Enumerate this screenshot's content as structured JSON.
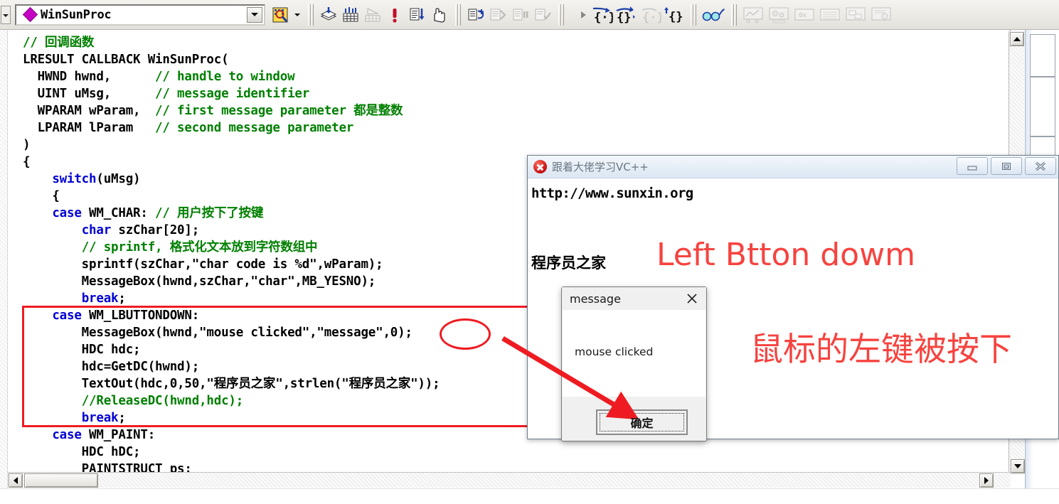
{
  "toolbar": {
    "combo_value": "WinSunProc",
    "combo_dropdown_label": "▼",
    "icons": [
      {
        "name": "left-stub-dropdown",
        "label": "▼"
      },
      {
        "name": "class-member-filter-icon",
        "label": ""
      },
      {
        "name": "compile-icon",
        "label": ""
      },
      {
        "name": "build-icon",
        "label": ""
      },
      {
        "name": "stop-build-icon",
        "label": ""
      },
      {
        "name": "execute-program-icon",
        "label": ""
      },
      {
        "name": "go-icon",
        "label": ""
      },
      {
        "name": "insert-breakpoint-icon",
        "label": ""
      },
      {
        "name": "restart-icon",
        "label": ""
      },
      {
        "name": "stop-debugging-icon",
        "label": ""
      },
      {
        "name": "break-execution-icon",
        "label": ""
      },
      {
        "name": "apply-code-changes-icon",
        "label": ""
      },
      {
        "name": "step-into-icon",
        "label": ""
      },
      {
        "name": "step-over-icon",
        "label": ""
      },
      {
        "name": "step-out-icon",
        "label": ""
      },
      {
        "name": "run-to-cursor-icon",
        "label": ""
      },
      {
        "name": "quickwatch-icon",
        "label": ""
      },
      {
        "name": "watch-window-icon",
        "label": ""
      },
      {
        "name": "variables-window-icon",
        "label": ""
      },
      {
        "name": "registers-window-icon",
        "label": ""
      },
      {
        "name": "memory-window-icon",
        "label": ""
      },
      {
        "name": "call-stack-window-icon",
        "label": ""
      },
      {
        "name": "disassembly-window-icon",
        "label": ""
      }
    ]
  },
  "editor": {
    "lines": [
      {
        "segments": [
          {
            "t": "// 回调函数",
            "c": "cm"
          }
        ]
      },
      {
        "segments": [
          {
            "t": "LRESULT CALLBACK WinSunProc(",
            "c": ""
          }
        ]
      },
      {
        "segments": [
          {
            "t": "  HWND hwnd,      ",
            "c": ""
          },
          {
            "t": "// handle to window",
            "c": "cm"
          }
        ]
      },
      {
        "segments": [
          {
            "t": "  UINT uMsg,      ",
            "c": ""
          },
          {
            "t": "// message identifier",
            "c": "cm"
          }
        ]
      },
      {
        "segments": [
          {
            "t": "  WPARAM wParam,  ",
            "c": ""
          },
          {
            "t": "// first message parameter ",
            "c": "cm"
          },
          {
            "t": "都是整数",
            "c": "cm"
          }
        ]
      },
      {
        "segments": [
          {
            "t": "  LPARAM lParam   ",
            "c": ""
          },
          {
            "t": "// second message parameter",
            "c": "cm"
          }
        ]
      },
      {
        "segments": [
          {
            "t": ")",
            "c": ""
          }
        ]
      },
      {
        "segments": [
          {
            "t": "{",
            "c": ""
          }
        ]
      },
      {
        "segments": [
          {
            "t": "    ",
            "c": ""
          },
          {
            "t": "switch",
            "c": "kw"
          },
          {
            "t": "(uMsg)",
            "c": ""
          }
        ]
      },
      {
        "segments": [
          {
            "t": "    {",
            "c": ""
          }
        ]
      },
      {
        "segments": [
          {
            "t": "    ",
            "c": ""
          },
          {
            "t": "case",
            "c": "kw"
          },
          {
            "t": " WM_CHAR: ",
            "c": ""
          },
          {
            "t": "// 用户按下了按键",
            "c": "cm"
          }
        ]
      },
      {
        "segments": [
          {
            "t": "        ",
            "c": ""
          },
          {
            "t": "char",
            "c": "kw"
          },
          {
            "t": " szChar[20];",
            "c": ""
          }
        ]
      },
      {
        "segments": [
          {
            "t": "        ",
            "c": ""
          },
          {
            "t": "// sprintf, 格式化文本放到字符数组中",
            "c": "cm"
          }
        ]
      },
      {
        "segments": [
          {
            "t": "        sprintf(szChar,\"char code is %d\",wParam);",
            "c": ""
          }
        ]
      },
      {
        "segments": [
          {
            "t": "        MessageBox(hwnd,szChar,\"char\",MB_YESNO);",
            "c": ""
          }
        ]
      },
      {
        "segments": [
          {
            "t": "        ",
            "c": ""
          },
          {
            "t": "break",
            "c": "kw"
          },
          {
            "t": ";",
            "c": ""
          }
        ]
      },
      {
        "segments": [
          {
            "t": "    ",
            "c": ""
          },
          {
            "t": "case",
            "c": "kw"
          },
          {
            "t": " WM_LBUTTONDOWN:",
            "c": ""
          }
        ]
      },
      {
        "segments": [
          {
            "t": "        MessageBox(hwnd,\"mouse clicked\",\"message\",0);",
            "c": ""
          }
        ]
      },
      {
        "segments": [
          {
            "t": "        HDC hdc;",
            "c": ""
          }
        ]
      },
      {
        "segments": [
          {
            "t": "        hdc=GetDC(hwnd);",
            "c": ""
          }
        ]
      },
      {
        "segments": [
          {
            "t": "        TextOut(hdc,0,50,\"程序员之家\",strlen(\"程序员之家\"));",
            "c": ""
          }
        ]
      },
      {
        "segments": [
          {
            "t": "        ",
            "c": ""
          },
          {
            "t": "//ReleaseDC(hwnd,hdc);",
            "c": "cm"
          }
        ]
      },
      {
        "segments": [
          {
            "t": "        ",
            "c": ""
          },
          {
            "t": "break",
            "c": "kw"
          },
          {
            "t": ";",
            "c": ""
          }
        ]
      },
      {
        "segments": [
          {
            "t": "    ",
            "c": ""
          },
          {
            "t": "case",
            "c": "kw"
          },
          {
            "t": " WM_PAINT:",
            "c": ""
          }
        ]
      },
      {
        "segments": [
          {
            "t": "        HDC hDC;",
            "c": ""
          }
        ]
      },
      {
        "segments": [
          {
            "t": "        PAINTSTRUCT ps;",
            "c": ""
          }
        ]
      }
    ]
  },
  "app_window": {
    "title": "跟着大佬学习VC++",
    "url_text": "http://www.sunxin.org",
    "drawn_text": "程序员之家",
    "minimize_label": "—",
    "maximize_label": "□",
    "close_label": "✕"
  },
  "annotations": {
    "english": "Left Btton dowm",
    "chinese": "鼠标的左键被按下",
    "highlight_color": "#ee1c22",
    "text_color": "#f6433f"
  },
  "message_box": {
    "title": "message",
    "body": "mouse clicked",
    "ok_label": "确定",
    "close_label": "✕"
  },
  "scrollbars": {
    "up_label": "▲",
    "down_label": "▼",
    "left_label": "◀",
    "right_label": "▶"
  }
}
